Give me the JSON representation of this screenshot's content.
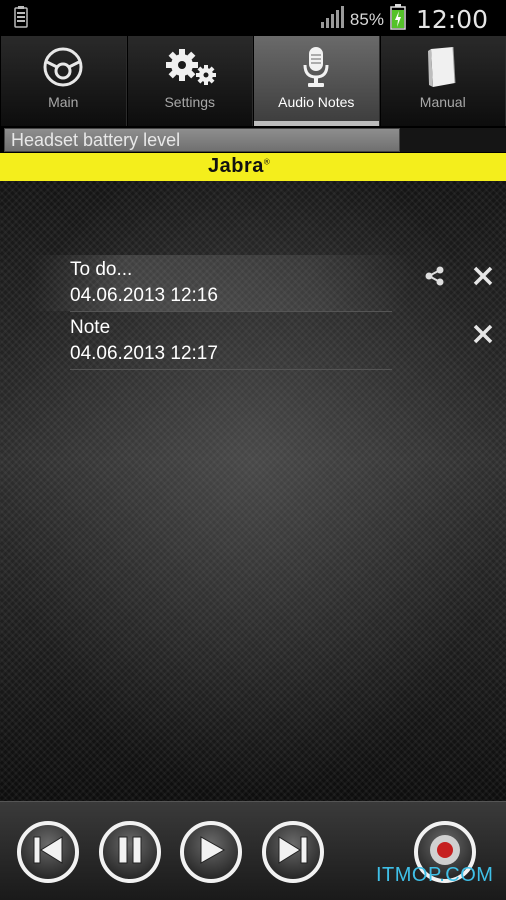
{
  "status_bar": {
    "battery_percent": "85%",
    "time": "12:00"
  },
  "tabs": [
    {
      "label": "Main",
      "icon": "target-icon",
      "active": false
    },
    {
      "label": "Settings",
      "icon": "gears-icon",
      "active": false
    },
    {
      "label": "Audio Notes",
      "icon": "microphone-icon",
      "active": true
    },
    {
      "label": "Manual",
      "icon": "book-icon",
      "active": false
    }
  ],
  "battery_bar": {
    "label": "Headset battery level"
  },
  "banner": {
    "brand": "Jabra"
  },
  "notes": [
    {
      "title": "To do...",
      "date": "04.06.2013 12:16",
      "shareable": true
    },
    {
      "title": "Note",
      "date": "04.06.2013 12:17",
      "shareable": false
    }
  ],
  "controls": [
    "previous-icon",
    "pause-icon",
    "play-icon",
    "next-icon",
    "record-icon"
  ],
  "colors": {
    "banner_yellow": "#f4ee1c",
    "record_red": "#c62020",
    "watermark": "#3fc0e8"
  },
  "watermark": "ITMOP.COM"
}
